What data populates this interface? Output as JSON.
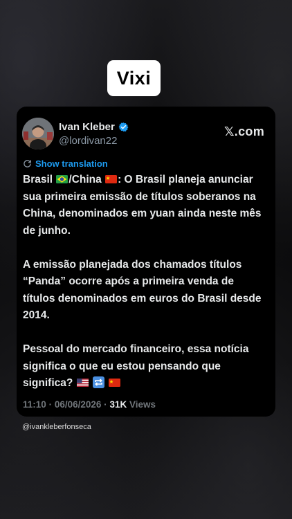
{
  "badge": {
    "label": "Vixi"
  },
  "tweet": {
    "author_name": "Ivan Kleber",
    "author_handle": "@lordivan22",
    "source": "𝕏.com",
    "translation_label": "Show translation",
    "paragraph1": {
      "part1": "Brasil",
      "part2": "/China",
      "part3": ": O Brasil planeja anunciar sua primeira emissão de títulos soberanos na China, denominados em yuan ainda neste mês de junho."
    },
    "paragraph2": "A emissão planejada dos chamados títulos “Panda” ocorre após a primeira venda de títulos denominados em euros do Brasil desde 2014.",
    "paragraph3": "Pessoal do mercado financeiro, essa notícia significa o que eu estou pensando que significa?",
    "time": "11:10",
    "separator": "·",
    "date": "06/06/2026",
    "views_count": "31K",
    "views_label": "Views"
  },
  "footer": {
    "handle": "@ivankleberfonseca"
  },
  "colors": {
    "link": "#1d9bf0",
    "verified": "#1d9bf0",
    "muted": "#71767b",
    "text": "#e7e9ea"
  },
  "icons": [
    "verified-icon",
    "translate-icon",
    "brazil-flag-icon",
    "china-flag-icon",
    "us-flag-icon",
    "repeat-emoji-icon"
  ]
}
